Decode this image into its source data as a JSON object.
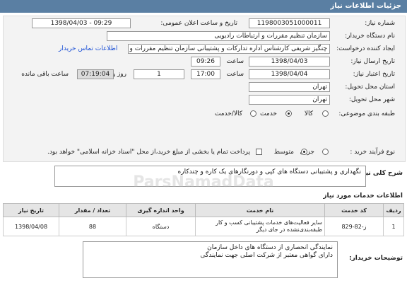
{
  "header": {
    "title": "جزئیات اطلاعات نیاز"
  },
  "form": {
    "need_number_label": "شماره نیاز:",
    "need_number": "1198003051000011",
    "announce_label": "تاریخ و ساعت اعلان عمومی:",
    "announce_value": "1398/04/03 - 09:29",
    "buyer_label": "نام دستگاه خریدار:",
    "buyer": "سازمان تنظیم مقررات و ارتباطات رادیویی",
    "creator_label": "ایجاد کننده درخواست:",
    "creator": "چنگیز شریفی کارشناس اداره تدارکات و پشتیبانی سازمان تنظیم مقررات و ارتباطات",
    "contact_link": "اطلاعات تماس خریدار",
    "send_date_label": "تاریخ ارسال نیاز:",
    "send_date": "1398/04/03",
    "send_time_label": "ساعت",
    "send_time": "09:26",
    "deadline_label": "تاریخ اعتبار نیاز:",
    "deadline_date": "1398/04/04",
    "deadline_time_label": "ساعت",
    "deadline_time": "17:00",
    "days": "1",
    "days_label": "روز و",
    "remaining": "07:19:04",
    "remaining_label": "ساعت باقی مانده",
    "province_label": "استان محل تحویل:",
    "province": "تهران",
    "city_label": "شهر محل تحویل:",
    "city": "تهران",
    "category_label": "طبقه بندی موضوعی:",
    "category_options": [
      "کالا",
      "خدمت",
      "کالا/خدمت"
    ],
    "category_selected": "خدمت",
    "process_label": "نوع فرآیند خرید :",
    "process_options": [
      "جزیی",
      "متوسط"
    ],
    "process_selected": "متوسط",
    "payment_note": "پرداخت تمام یا بخشی از مبلغ خرید،از محل \"اسناد خزانه اسلامی\" خواهد بود."
  },
  "summary": {
    "label": "شرح کلی نیاز:",
    "value": "نگهداری و پشتیبانی دستگاه های کپی و دورنگارهای یک کاره و چندکاره"
  },
  "services": {
    "title": "اطلاعات خدمات مورد نیاز",
    "columns": [
      "ردیف",
      "کد خدمت",
      "نام خدمت",
      "واحد اندازه گیری",
      "تعداد / مقدار",
      "تاریخ نیاز"
    ],
    "rows": [
      [
        "1",
        "ز-82-829",
        "سایر فعالیت‌های خدمات پشتیبانی کسب و کار طبقه‌بندی‌نشده در جای دیگر",
        "دستگاه",
        "88",
        "1398/04/08"
      ]
    ]
  },
  "buyer_notes": {
    "label": "توضیحات خریدار:",
    "line1": "نمایندگی انحصاری  از دستگاه های داخل سازمان",
    "line2": "دارای گواهی معتبر از شرکت اصلی جهت نمایندگی"
  },
  "watermark": "ParsNamadData"
}
